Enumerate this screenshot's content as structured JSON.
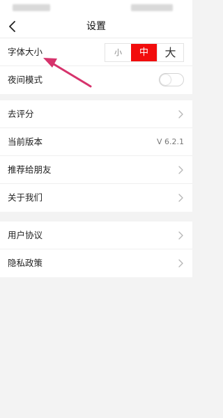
{
  "nav": {
    "title": "设置"
  },
  "font_size": {
    "label": "字体大小",
    "options": [
      "小",
      "中",
      "大"
    ],
    "selected": "中"
  },
  "night_mode": {
    "label": "夜间模式",
    "enabled": false
  },
  "group2": {
    "rate": "去评分",
    "version_label": "当前版本",
    "version_value": "V 6.2.1",
    "recommend": "推荐给朋友",
    "about": "关于我们"
  },
  "group3": {
    "agreement": "用户协议",
    "privacy": "隐私政策"
  },
  "colors": {
    "accent": "#f20c0c",
    "annotation_arrow": "#d6336c",
    "background": "#f3f3f3"
  }
}
